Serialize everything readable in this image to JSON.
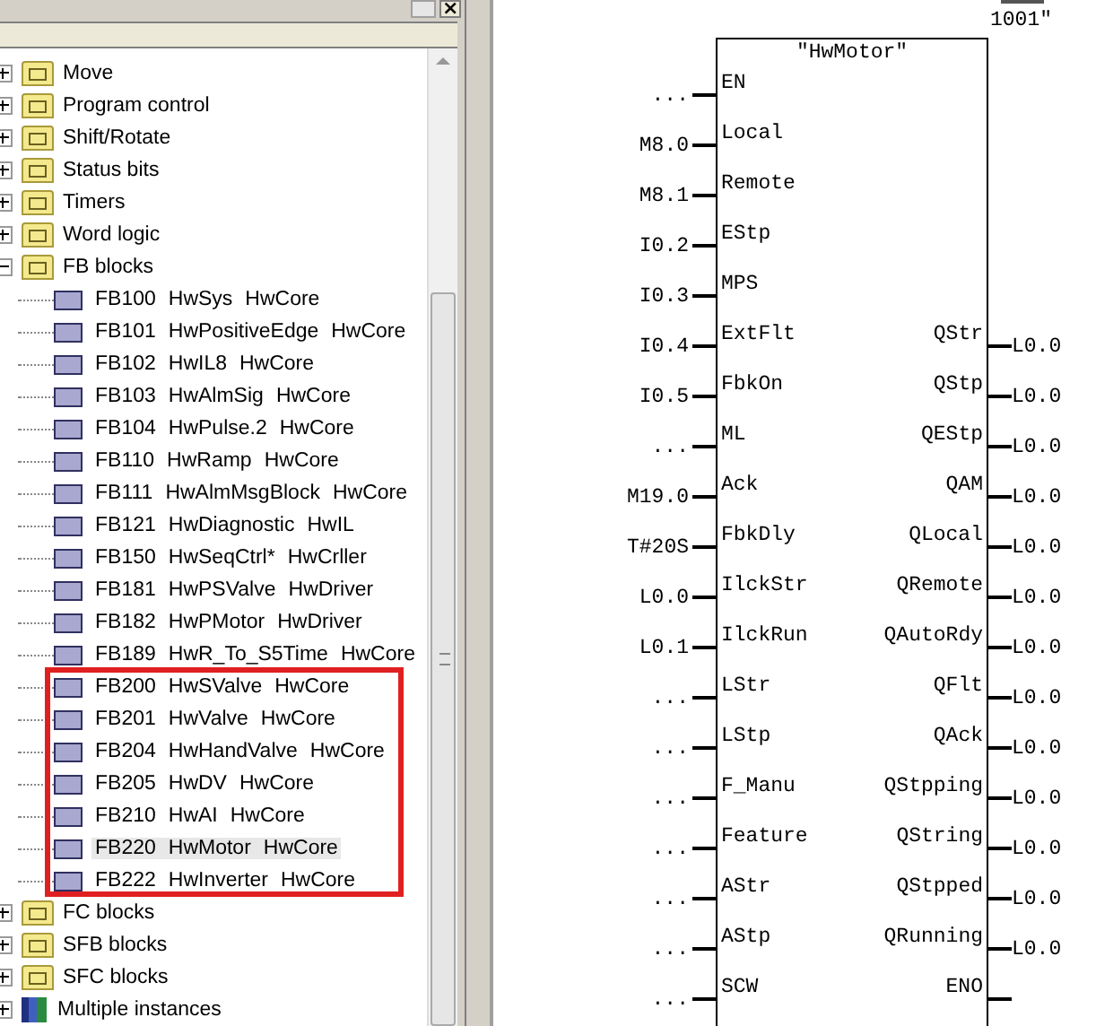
{
  "left_pane": {
    "close_button": "×",
    "tree": [
      {
        "label": "Move",
        "kind": "folder",
        "expanded": false
      },
      {
        "label": "Program control",
        "kind": "folder",
        "expanded": false
      },
      {
        "label": "Shift/Rotate",
        "kind": "folder",
        "expanded": false
      },
      {
        "label": "Status bits",
        "kind": "folder",
        "expanded": false
      },
      {
        "label": "Timers",
        "kind": "folder",
        "expanded": false
      },
      {
        "label": "Word logic",
        "kind": "folder",
        "expanded": false
      },
      {
        "label": "FB blocks",
        "kind": "folder",
        "expanded": true,
        "children": [
          {
            "number": "FB100",
            "name": "HwSys",
            "family": "HwCore",
            "selected": false
          },
          {
            "number": "FB101",
            "name": "HwPositiveEdge",
            "family": "HwCore",
            "selected": false
          },
          {
            "number": "FB102",
            "name": "HwIL8",
            "family": "HwCore",
            "selected": false
          },
          {
            "number": "FB103",
            "name": "HwAlmSig",
            "family": "HwCore",
            "selected": false
          },
          {
            "number": "FB104",
            "name": "HwPulse.2",
            "family": "HwCore",
            "selected": false
          },
          {
            "number": "FB110",
            "name": "HwRamp",
            "family": "HwCore",
            "selected": false
          },
          {
            "number": "FB111",
            "name": "HwAlmMsgBlock",
            "family": "HwCore",
            "selected": false
          },
          {
            "number": "FB121",
            "name": "HwDiagnostic",
            "family": "HwIL",
            "selected": false
          },
          {
            "number": "FB150",
            "name": "HwSeqCtrl*",
            "family": "HwCrller",
            "selected": false
          },
          {
            "number": "FB181",
            "name": "HwPSValve",
            "family": "HwDriver",
            "selected": false
          },
          {
            "number": "FB182",
            "name": "HwPMotor",
            "family": "HwDriver",
            "selected": false
          },
          {
            "number": "FB189",
            "name": "HwR_To_S5Time",
            "family": "HwCore",
            "selected": false
          },
          {
            "number": "FB200",
            "name": "HwSValve",
            "family": "HwCore",
            "selected": false
          },
          {
            "number": "FB201",
            "name": "HwValve",
            "family": "HwCore",
            "selected": false
          },
          {
            "number": "FB204",
            "name": "HwHandValve",
            "family": "HwCore",
            "selected": false
          },
          {
            "number": "FB205",
            "name": "HwDV",
            "family": "HwCore",
            "selected": false
          },
          {
            "number": "FB210",
            "name": "HwAI",
            "family": "HwCore",
            "selected": false
          },
          {
            "number": "FB220",
            "name": "HwMotor",
            "family": "HwCore",
            "selected": true
          },
          {
            "number": "FB222",
            "name": "HwInverter",
            "family": "HwCore",
            "selected": false
          }
        ]
      },
      {
        "label": "FC blocks",
        "kind": "folder",
        "expanded": false
      },
      {
        "label": "SFB blocks",
        "kind": "folder",
        "expanded": false
      },
      {
        "label": "SFC blocks",
        "kind": "folder",
        "expanded": false
      },
      {
        "label": "Multiple instances",
        "kind": "instances",
        "expanded": false
      }
    ]
  },
  "diagram": {
    "instance": "1001\"",
    "block_name": "\"HwMotor\"",
    "rows": [
      {
        "in_value": "...",
        "in_pin": "EN"
      },
      {
        "in_value": "M8.0",
        "in_pin": "Local"
      },
      {
        "in_value": "M8.1",
        "in_pin": "Remote"
      },
      {
        "in_value": "I0.2",
        "in_pin": "EStp"
      },
      {
        "in_value": "I0.3",
        "in_pin": "MPS"
      },
      {
        "in_value": "I0.4",
        "in_pin": "ExtFlt",
        "out_pin": "QStr",
        "out_value": "L0.0"
      },
      {
        "in_value": "I0.5",
        "in_pin": "FbkOn",
        "out_pin": "QStp",
        "out_value": "L0.0"
      },
      {
        "in_value": "...",
        "in_pin": "ML",
        "out_pin": "QEStp",
        "out_value": "L0.0"
      },
      {
        "in_value": "M19.0",
        "in_pin": "Ack",
        "out_pin": "QAM",
        "out_value": "L0.0"
      },
      {
        "in_value": "T#20S",
        "in_pin": "FbkDly",
        "out_pin": "QLocal",
        "out_value": "L0.0"
      },
      {
        "in_value": "L0.0",
        "in_pin": "IlckStr",
        "out_pin": "QRemote",
        "out_value": "L0.0"
      },
      {
        "in_value": "L0.1",
        "in_pin": "IlckRun",
        "out_pin": "QAutoRdy",
        "out_value": "L0.0"
      },
      {
        "in_value": "...",
        "in_pin": "LStr",
        "out_pin": "QFlt",
        "out_value": "L0.0"
      },
      {
        "in_value": "...",
        "in_pin": "LStp",
        "out_pin": "QAck",
        "out_value": "L0.0"
      },
      {
        "in_value": "...",
        "in_pin": "F_Manu",
        "out_pin": "QStpping",
        "out_value": "L0.0"
      },
      {
        "in_value": "...",
        "in_pin": "Feature",
        "out_pin": "QString",
        "out_value": "L0.0"
      },
      {
        "in_value": "...",
        "in_pin": "AStr",
        "out_pin": "QStpped",
        "out_value": "L0.0"
      },
      {
        "in_value": "...",
        "in_pin": "AStp",
        "out_pin": "QRunning",
        "out_value": "L0.0"
      },
      {
        "in_value": "...",
        "in_pin": "SCW",
        "out_pin": "ENO",
        "out_stub": true
      }
    ]
  }
}
